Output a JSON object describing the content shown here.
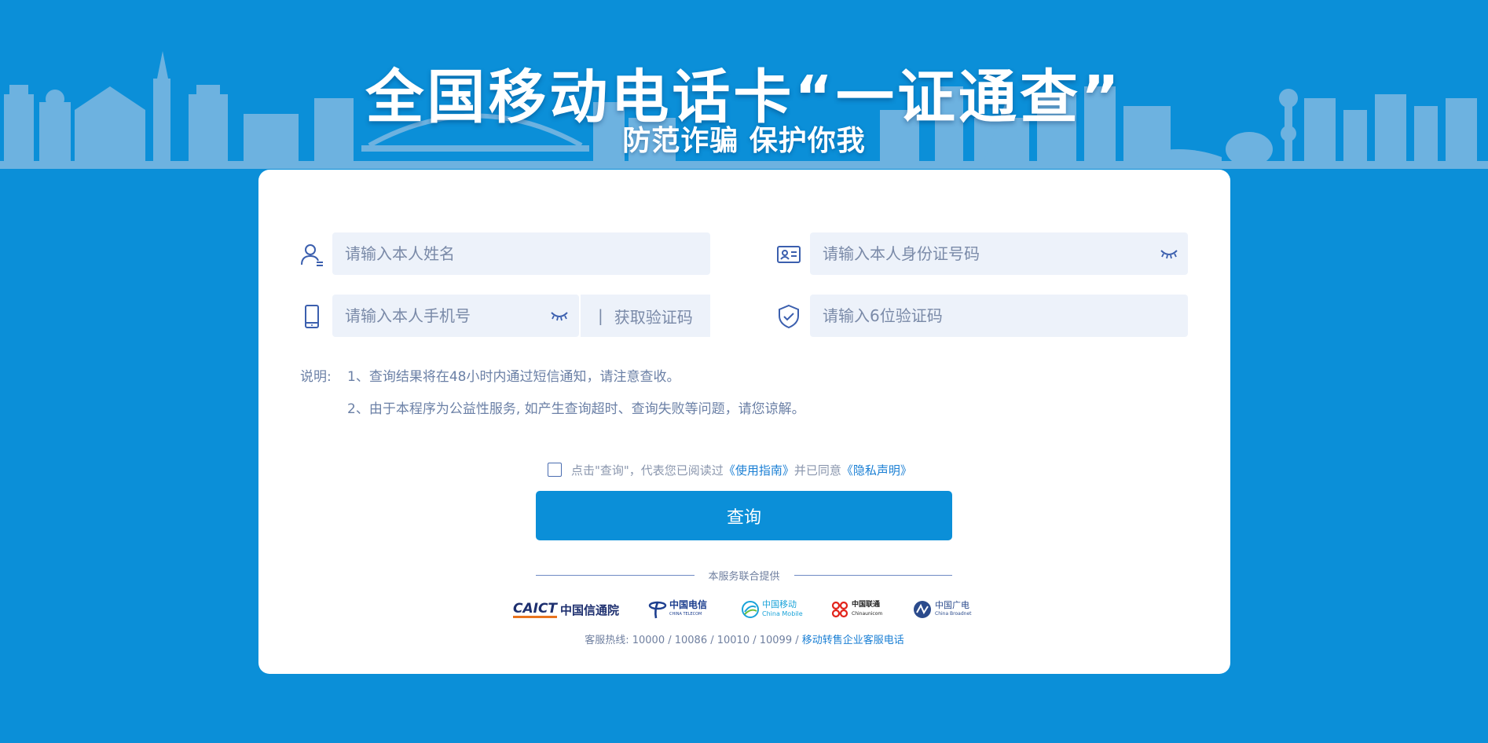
{
  "header": {
    "title": "全国移动电话卡“一证通查”",
    "subtitle": "防范诈骗 保护你我"
  },
  "form": {
    "name_placeholder": "请输入本人姓名",
    "id_placeholder": "请输入本人身份证号码",
    "phone_placeholder": "请输入本人手机号",
    "get_code_separator": "|",
    "get_code_label": "获取验证码",
    "code_placeholder": "请输入6位验证码"
  },
  "notes": {
    "label": "说明:",
    "items": [
      "1、查询结果将在48小时内通过短信通知，请注意查收。",
      "2、由于本程序为公益性服务, 如产生查询超时、查询失败等问题，请您谅解。"
    ]
  },
  "agreement": {
    "prefix": "点击\"查询\"，代表您已阅读过",
    "guide_link": "《使用指南》",
    "middle": "并已同意",
    "privacy_link": "《隐私声明》"
  },
  "submit_label": "查询",
  "provider": {
    "label": "本服务联合提供",
    "logos": [
      {
        "mark": "CAICT",
        "text": "中国信通院"
      },
      {
        "text": "中国电信",
        "sub": "CHINA TELECOM"
      },
      {
        "text": "中国移动",
        "sub": "China Mobile"
      },
      {
        "text": "中国联通",
        "sub": "Chinaunicom"
      },
      {
        "text": "中国广电",
        "sub": "China Broadnet"
      }
    ]
  },
  "hotline": {
    "text": "客服热线: 10000 / 10086 / 10010 / 10099 /",
    "link": "移动转售企业客服电话"
  },
  "colors": {
    "background": "#0b8fd8",
    "accent": "#0b8fd8",
    "input_bg": "#edf2fa",
    "link": "#1a7fd4"
  }
}
